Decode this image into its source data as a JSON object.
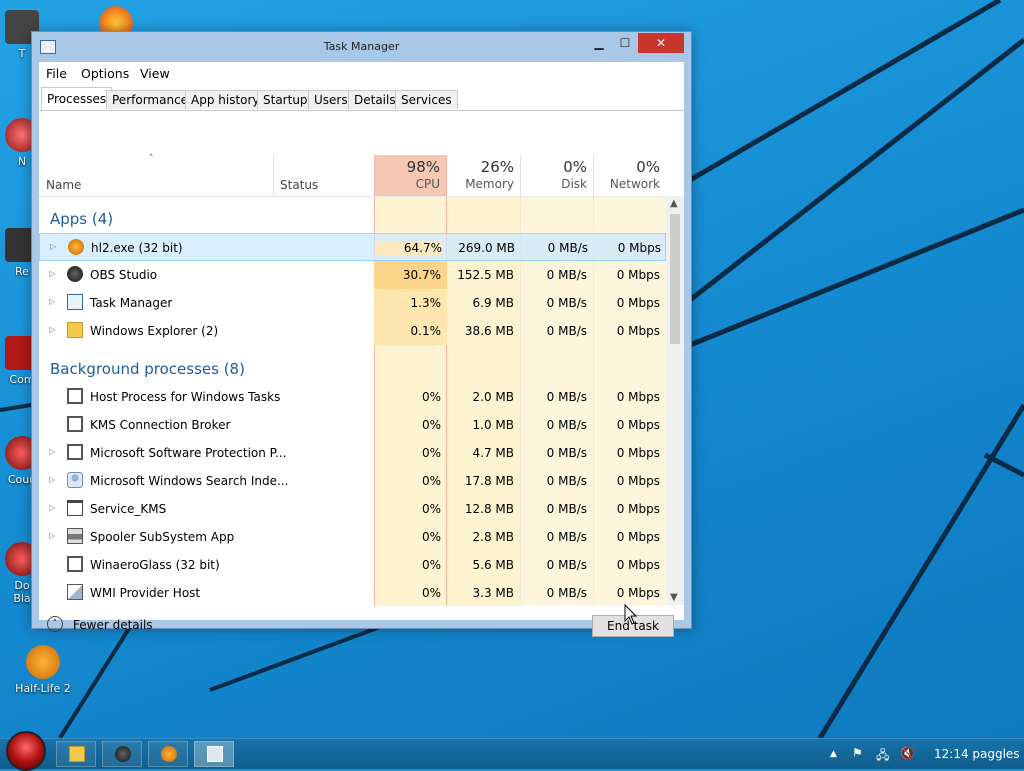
{
  "desktop": {
    "icons": [
      {
        "label": "T"
      },
      {
        "label": "N"
      },
      {
        "label": "Re"
      },
      {
        "label": "Com"
      },
      {
        "label": "Coun"
      },
      {
        "label": "Do"
      },
      {
        "label": "Bla"
      },
      {
        "label": "Half-Life 2"
      }
    ]
  },
  "window": {
    "title": "Task Manager",
    "buttons": {
      "minimize": "▁",
      "maximize": "☐",
      "close": "✕"
    },
    "menu": [
      "File",
      "Options",
      "View"
    ],
    "tabs": [
      "Processes",
      "Performance",
      "App history",
      "Startup",
      "Users",
      "Details",
      "Services"
    ],
    "active_tab": "Processes",
    "columns": {
      "sort_indicator": "˄",
      "name": "Name",
      "status": "Status",
      "cpu": {
        "pct": "98%",
        "label": "CPU"
      },
      "memory": {
        "pct": "26%",
        "label": "Memory"
      },
      "disk": {
        "pct": "0%",
        "label": "Disk"
      },
      "network": {
        "pct": "0%",
        "label": "Network"
      }
    },
    "groups": {
      "apps": {
        "title": "Apps (4)",
        "rows": [
          {
            "expander": "▷",
            "name": "hl2.exe (32 bit)",
            "cpu": "64.7%",
            "memory": "269.0 MB",
            "disk": "0 MB/s",
            "network": "0 Mbps"
          },
          {
            "expander": "▷",
            "name": "OBS Studio",
            "cpu": "30.7%",
            "memory": "152.5 MB",
            "disk": "0 MB/s",
            "network": "0 Mbps"
          },
          {
            "expander": "▷",
            "name": "Task Manager",
            "cpu": "1.3%",
            "memory": "6.9 MB",
            "disk": "0 MB/s",
            "network": "0 Mbps"
          },
          {
            "expander": "▷",
            "name": "Windows Explorer (2)",
            "cpu": "0.1%",
            "memory": "38.6 MB",
            "disk": "0 MB/s",
            "network": "0 Mbps"
          }
        ]
      },
      "background": {
        "title": "Background processes (8)",
        "rows": [
          {
            "expander": "",
            "name": "Host Process for Windows Tasks",
            "cpu": "0%",
            "memory": "2.0 MB",
            "disk": "0 MB/s",
            "network": "0 Mbps"
          },
          {
            "expander": "",
            "name": "KMS Connection Broker",
            "cpu": "0%",
            "memory": "1.0 MB",
            "disk": "0 MB/s",
            "network": "0 Mbps"
          },
          {
            "expander": "▷",
            "name": "Microsoft Software Protection P...",
            "cpu": "0%",
            "memory": "4.7 MB",
            "disk": "0 MB/s",
            "network": "0 Mbps"
          },
          {
            "expander": "▷",
            "name": "Microsoft Windows Search Inde...",
            "cpu": "0%",
            "memory": "17.8 MB",
            "disk": "0 MB/s",
            "network": "0 Mbps"
          },
          {
            "expander": "▷",
            "name": "Service_KMS",
            "cpu": "0%",
            "memory": "12.8 MB",
            "disk": "0 MB/s",
            "network": "0 Mbps"
          },
          {
            "expander": "▷",
            "name": "Spooler SubSystem App",
            "cpu": "0%",
            "memory": "2.8 MB",
            "disk": "0 MB/s",
            "network": "0 Mbps"
          },
          {
            "expander": "",
            "name": "WinaeroGlass (32 bit)",
            "cpu": "0%",
            "memory": "5.6 MB",
            "disk": "0 MB/s",
            "network": "0 Mbps"
          },
          {
            "expander": "",
            "name": "WMI Provider Host",
            "cpu": "0%",
            "memory": "3.3 MB",
            "disk": "0 MB/s",
            "network": "0 Mbps"
          }
        ]
      }
    },
    "scroll": {
      "up": "▲",
      "down": "▼"
    },
    "footer": {
      "fewer_icon": "˄",
      "fewer_details": "Fewer details",
      "end_task": "End task"
    }
  },
  "taskbar": {
    "tray": {
      "arrow": "▲",
      "flag": "⚑",
      "network": "🖧",
      "volume": "🔇"
    },
    "clock": "12:14 paggles"
  },
  "colors": {
    "cpu_header": "#f7c7b6",
    "cpu_high": "#fcd58a",
    "cpu_mid": "#fde6b0",
    "cell_low": "#fdf3d0",
    "selection": "#cce8ff",
    "group_title": "#1f5c9e",
    "close_button": "#c7352b",
    "desktop": "#1793d6"
  }
}
